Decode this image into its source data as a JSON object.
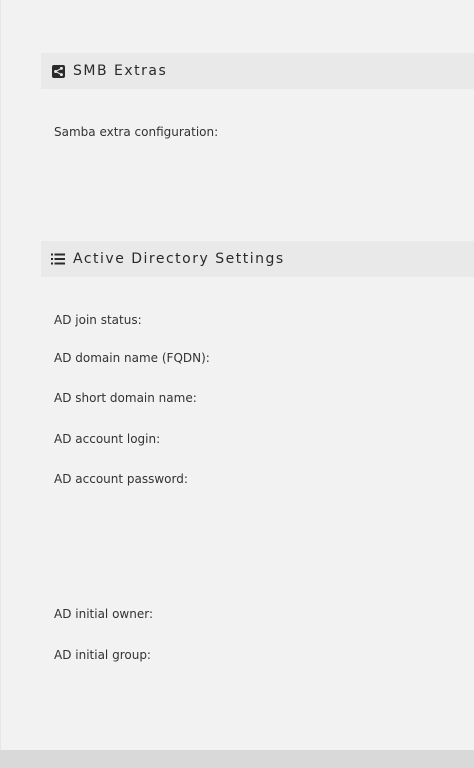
{
  "smb_extras": {
    "title": "SMB Extras",
    "icon": "share-icon",
    "fields": [
      {
        "label": "Samba extra configuration:"
      }
    ]
  },
  "ad_settings": {
    "title": "Active Directory Settings",
    "icon": "list-icon",
    "fields": [
      {
        "label": "AD join status:"
      },
      {
        "label": "AD domain name (FQDN):"
      },
      {
        "label": "AD short domain name:"
      },
      {
        "label": "AD account login:"
      },
      {
        "label": "AD account password:"
      },
      {
        "label": "AD initial owner:"
      },
      {
        "label": "AD initial group:"
      }
    ]
  }
}
